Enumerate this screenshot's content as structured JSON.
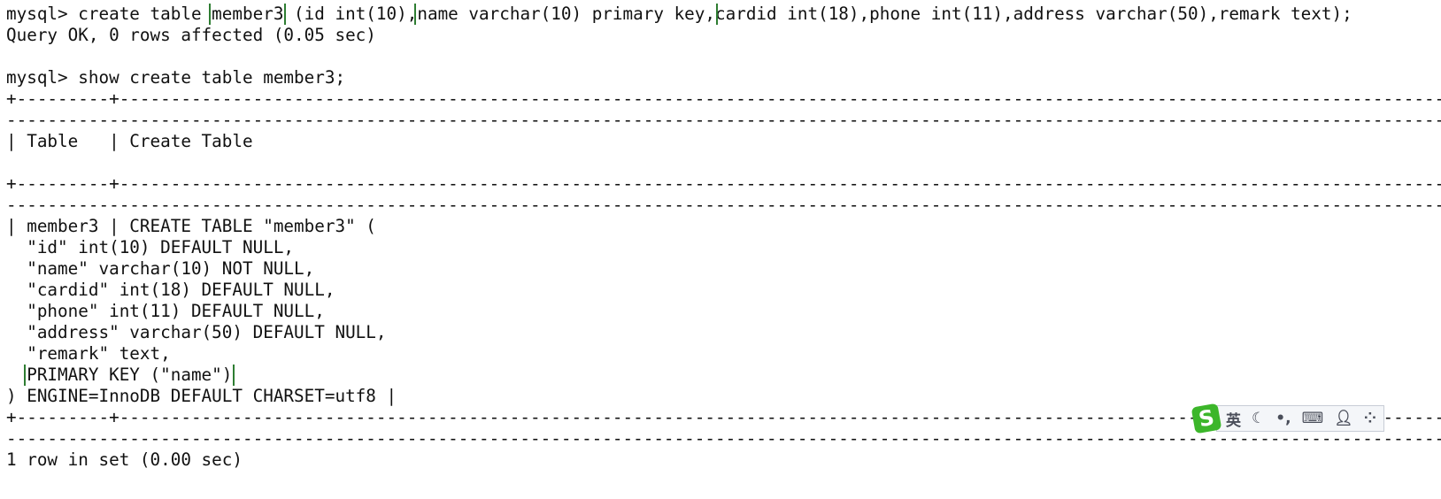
{
  "terminal": {
    "lines": [
      [
        {
          "t": "mysql> create table "
        },
        {
          "t": "member3",
          "hl": true
        },
        {
          "t": " (id int(10),"
        },
        {
          "t": "name varchar(10) primary key,",
          "hl": true
        },
        {
          "t": "cardid int(18),phone int(11),address varchar(50),remark text);"
        }
      ],
      [
        {
          "t": "Query OK, 0 rows affected (0.05 sec)"
        }
      ],
      [
        {
          "t": ""
        }
      ],
      [
        {
          "t": "mysql> show create table member3;"
        }
      ],
      [
        {
          "t": "+---------+-------------------------------------------------------------------------------------------------------------------------------------------------------"
        }
      ],
      [
        {
          "t": "--------------------------------------------------------------------------------------------------------------------------------------------------------------"
        }
      ],
      [
        {
          "t": "| Table   | Create Table"
        }
      ],
      [
        {
          "t": ""
        }
      ],
      [
        {
          "t": "+---------+-------------------------------------------------------------------------------------------------------------------------------------------------------"
        }
      ],
      [
        {
          "t": "--------------------------------------------------------------------------------------------------------------------------------------------------------------"
        }
      ],
      [
        {
          "t": "| member3 | CREATE TABLE \"member3\" ("
        }
      ],
      [
        {
          "t": "  \"id\" int(10) DEFAULT NULL,"
        }
      ],
      [
        {
          "t": "  \"name\" varchar(10) NOT NULL,"
        }
      ],
      [
        {
          "t": "  \"cardid\" int(18) DEFAULT NULL,"
        }
      ],
      [
        {
          "t": "  \"phone\" int(11) DEFAULT NULL,"
        }
      ],
      [
        {
          "t": "  \"address\" varchar(50) DEFAULT NULL,"
        }
      ],
      [
        {
          "t": "  \"remark\" text,"
        }
      ],
      [
        {
          "t": "  "
        },
        {
          "t": "PRIMARY KEY (\"name\")",
          "hl": true
        }
      ],
      [
        {
          "t": ") ENGINE=InnoDB DEFAULT CHARSET=utf8 |"
        }
      ],
      [
        {
          "t": "+---------+-------------------------------------------------------------------------------------------------------------------------------------------------------"
        }
      ],
      [
        {
          "t": "--------------------------------------------------------------------------------------------------------------------------------------------------------------"
        }
      ],
      [
        {
          "t": "1 row in set (0.00 sec)"
        }
      ]
    ],
    "highlight_color": "#2e7d32"
  },
  "ime_toolbar": {
    "logo": "S",
    "mode": "英",
    "icons": [
      "moon-icon",
      "punctuation-icon",
      "keyboard-icon",
      "user-icon",
      "apps-icon"
    ],
    "logo_color": "#3cb62a"
  }
}
